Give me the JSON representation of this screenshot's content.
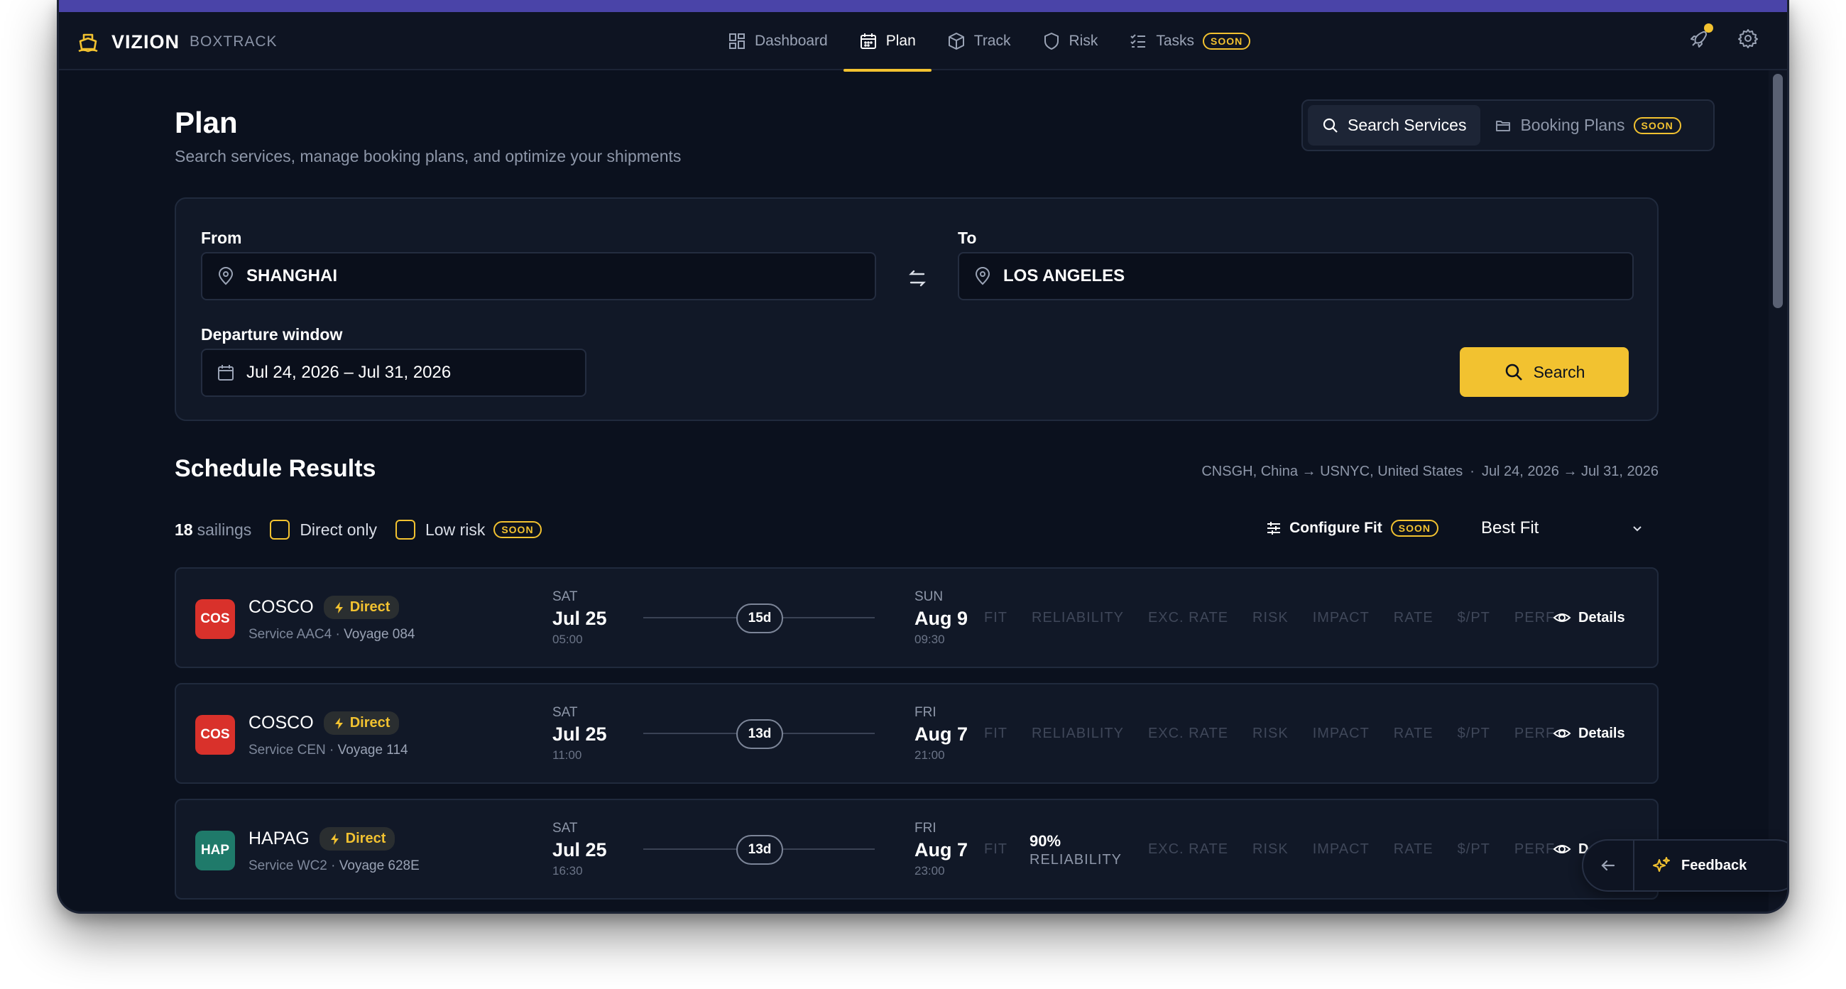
{
  "brand": {
    "name": "VIZION",
    "product": "BOXTRACK"
  },
  "nav": [
    {
      "label": "Dashboard",
      "icon": "dashboard-icon"
    },
    {
      "label": "Plan",
      "icon": "calendar-icon",
      "active": true
    },
    {
      "label": "Track",
      "icon": "box-icon"
    },
    {
      "label": "Risk",
      "icon": "shield-icon"
    },
    {
      "label": "Tasks",
      "icon": "tasks-icon",
      "badge": "SOON"
    }
  ],
  "page": {
    "title": "Plan",
    "subtitle": "Search services, manage booking plans, and optimize your shipments"
  },
  "toggle": {
    "search_services": "Search Services",
    "booking_plans": "Booking Plans",
    "booking_badge": "SOON"
  },
  "search": {
    "from_label": "From",
    "from_value": "SHANGHAI",
    "to_label": "To",
    "to_value": "LOS ANGELES",
    "window_label": "Departure window",
    "window_value": "Jul 24, 2026 – Jul 31, 2026",
    "button": "Search"
  },
  "results": {
    "title": "Schedule Results",
    "route": "CNSGH, China → USNYC, United States",
    "sep": "·",
    "dates": "Jul 24, 2026 → Jul 31, 2026",
    "count": "18",
    "count_label": "sailings",
    "direct_only": "Direct only",
    "low_risk": "Low risk",
    "low_risk_badge": "SOON",
    "configure": "Configure Fit",
    "configure_badge": "SOON",
    "sort": "Best Fit"
  },
  "metric_labels": [
    "FIT",
    "RELIABILITY",
    "EXC. RATE",
    "RISK",
    "IMPACT",
    "RATE",
    "$/PT",
    "PERF"
  ],
  "sailings": [
    {
      "logo": "COS",
      "logo_color": "#d9312b",
      "carrier": "COSCO",
      "badge": "Direct",
      "service": "Service AAC4",
      "voyage": "Voyage 084",
      "dep_dow": "SAT",
      "dep_date": "Jul 25",
      "dep_time": "05:00",
      "duration": "15d",
      "arr_dow": "SUN",
      "arr_date": "Aug 9",
      "arr_time": "09:30",
      "details": "Details"
    },
    {
      "logo": "COS",
      "logo_color": "#d9312b",
      "carrier": "COSCO",
      "badge": "Direct",
      "service": "Service CEN",
      "voyage": "Voyage 114",
      "dep_dow": "SAT",
      "dep_date": "Jul 25",
      "dep_time": "11:00",
      "duration": "13d",
      "arr_dow": "FRI",
      "arr_date": "Aug 7",
      "arr_time": "21:00",
      "details": "Details"
    },
    {
      "logo": "HAP",
      "logo_color": "#1f7a6a",
      "carrier": "HAPAG",
      "badge": "Direct",
      "service": "Service WC2",
      "voyage": "Voyage 628E",
      "dep_dow": "SAT",
      "dep_date": "Jul 25",
      "dep_time": "16:30",
      "duration": "13d",
      "arr_dow": "FRI",
      "arr_date": "Aug 7",
      "arr_time": "23:00",
      "reliability_value": "90%",
      "reliability_label": "RELIABILITY",
      "details": "D"
    }
  ],
  "feedback": {
    "label": "Feedback"
  },
  "colors": {
    "accent": "#f2c230",
    "bg": "#0b111e",
    "panel": "#111827",
    "topstrip": "#4a44a8"
  }
}
